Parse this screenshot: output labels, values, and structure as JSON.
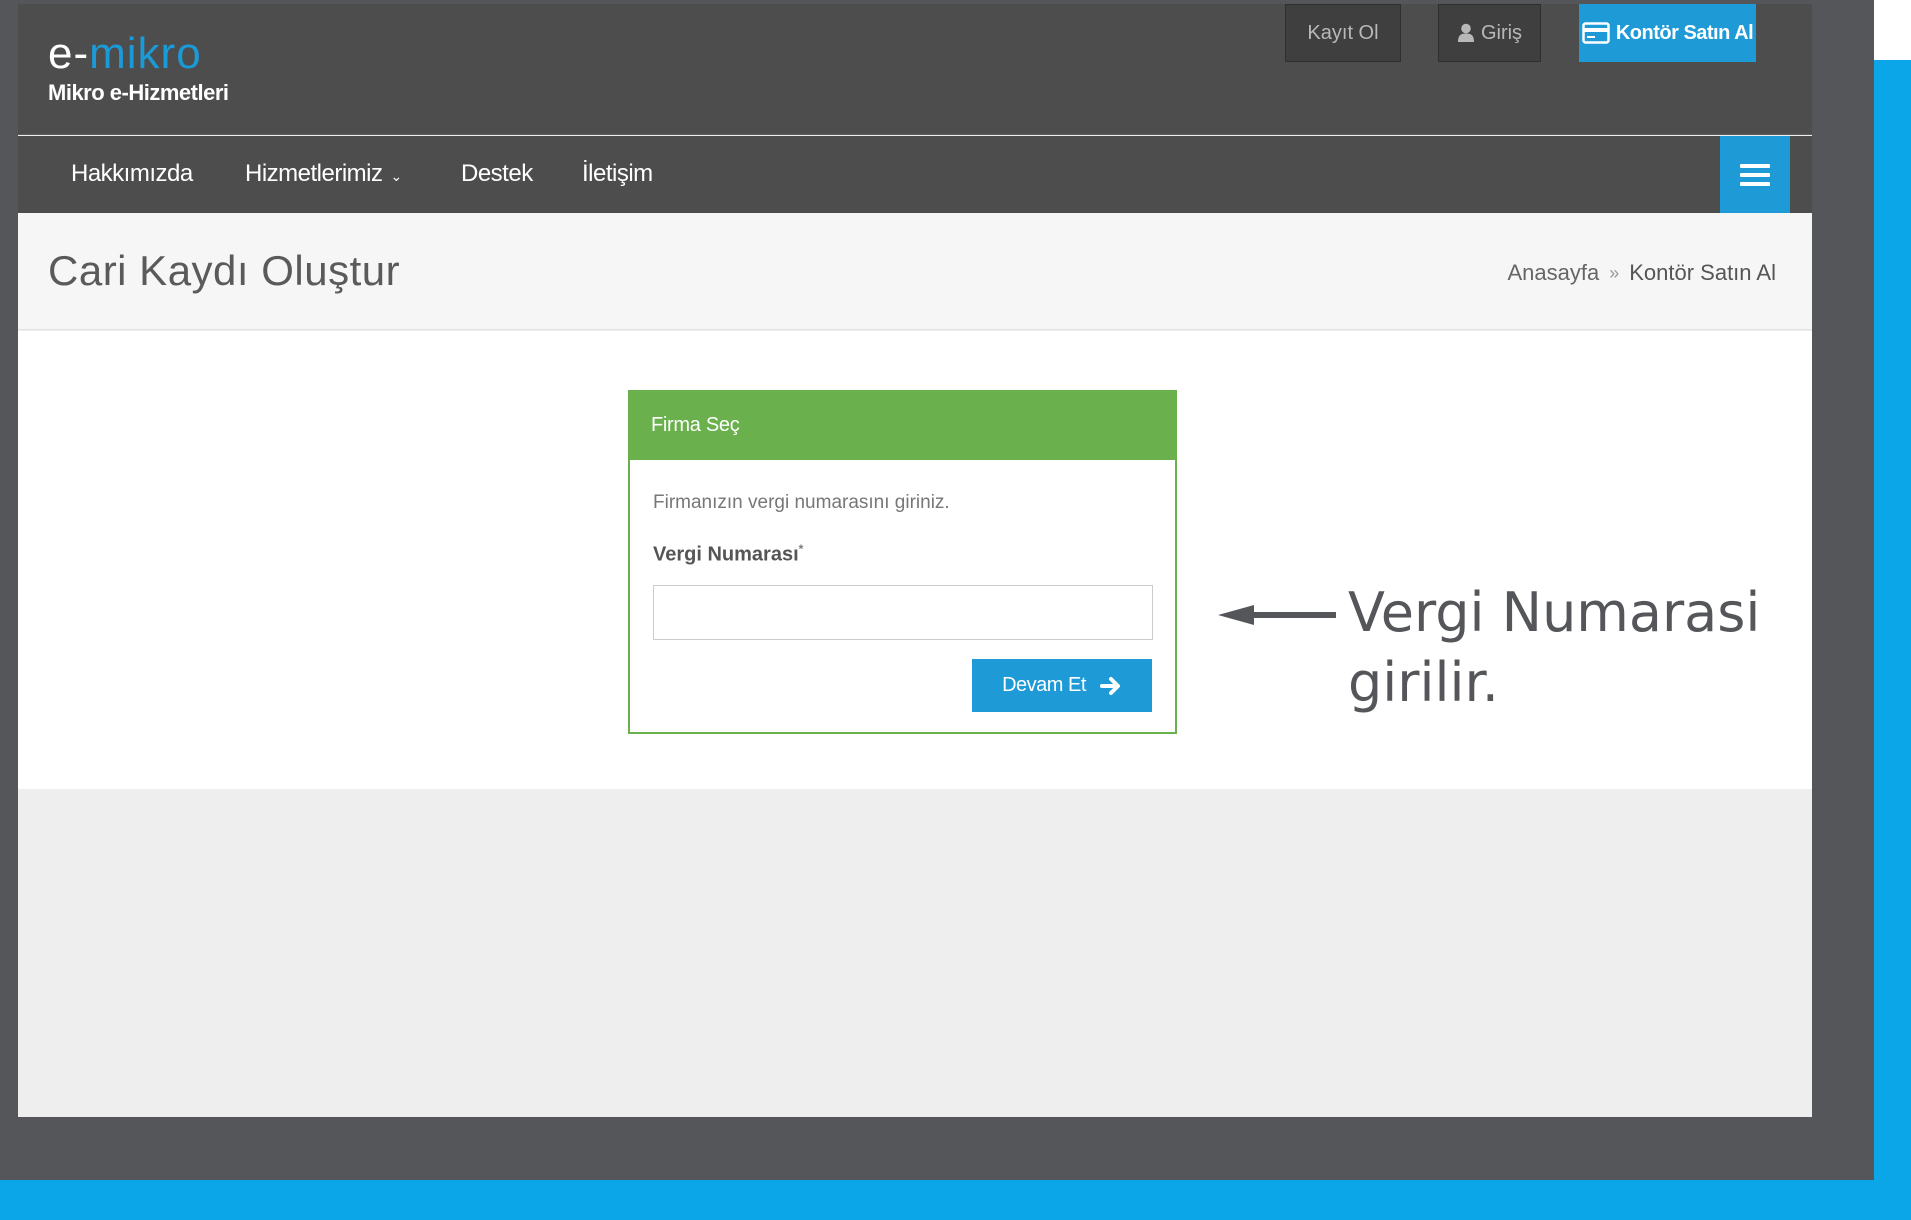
{
  "logo": {
    "prefix": "e-",
    "brand": "mikro",
    "subtitle": "Mikro e-Hizmetleri"
  },
  "top_buttons": {
    "register": "Kayıt Ol",
    "login": "Giriş",
    "buy": "Kontör Satın Al"
  },
  "nav": {
    "items": [
      "Hakkımızda",
      "Hizmetlerimiz",
      "Destek",
      "İletişim"
    ]
  },
  "page": {
    "title": "Cari Kaydı Oluştur",
    "breadcrumb": {
      "home": "Anasayfa",
      "separator": "»",
      "current": "Kontör Satın Al"
    }
  },
  "panel": {
    "header": "Firma Seç",
    "info": "Firmanızın vergi numarasını giriniz.",
    "field_label": "Vergi Numarası",
    "required_mark": "*",
    "field_value": "",
    "submit_label": "Devam Et"
  },
  "annotation": {
    "line1": "Vergi Numarasi",
    "line2": "girilir."
  },
  "colors": {
    "accent": "#1e9ad6",
    "panel_green": "#6ab04c",
    "frame_blue": "#0aa6e8",
    "header_dark": "#4d4d4d"
  }
}
